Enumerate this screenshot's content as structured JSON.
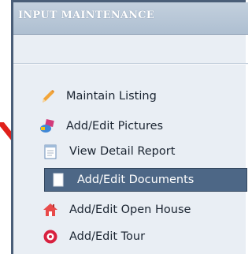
{
  "panel": {
    "title": "INPUT MAINTENANCE"
  },
  "menu": {
    "items": [
      {
        "label": "Maintain Listing",
        "icon": "pencil-icon"
      },
      {
        "label": "Add/Edit Pictures",
        "icon": "pictures-icon"
      },
      {
        "label": "View Detail Report",
        "icon": "report-icon"
      },
      {
        "label": "Add/Edit Documents",
        "icon": "document-icon",
        "selected": true
      },
      {
        "label": "Add/Edit Open House",
        "icon": "house-icon"
      },
      {
        "label": "Add/Edit Tour",
        "icon": "tour-icon"
      }
    ]
  },
  "annotation": {
    "icon": "red-arrow-icon",
    "color": "#e0201b"
  },
  "colors": {
    "header": "#aebfd1",
    "panel": "#e9eef4",
    "selected": "#4d6786"
  }
}
